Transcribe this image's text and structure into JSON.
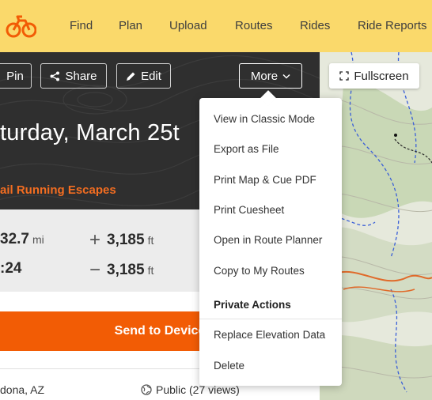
{
  "nav": {
    "items": [
      "Find",
      "Plan",
      "Upload",
      "Routes",
      "Rides",
      "Ride Reports"
    ]
  },
  "header": {
    "pin_label": "Pin",
    "share_label": "Share",
    "edit_label": "Edit",
    "more_label": "More",
    "title": "turday, March 25t",
    "collection": "ail Running Escapes"
  },
  "stats": {
    "distance_value": "32.7",
    "distance_unit": "mi",
    "time_value": ":24",
    "elevation_gain_value": "3,185",
    "elevation_gain_unit": "ft",
    "elevation_loss_value": "3,185",
    "elevation_loss_unit": "ft"
  },
  "actions": {
    "send_to_device": "Send to Device"
  },
  "footer": {
    "location": "dona, AZ",
    "visibility": "Public (27 views)"
  },
  "map": {
    "fullscreen_label": "Fullscreen"
  },
  "dropdown": {
    "items": [
      "View in Classic Mode",
      "Export as File",
      "Print Map & Cue PDF",
      "Print Cuesheet",
      "Open in Route Planner",
      "Copy to My Routes"
    ],
    "private_header": "Private Actions",
    "private_items": [
      "Replace Elevation Data",
      "Delete"
    ]
  },
  "colors": {
    "nav_bg": "#fad96b",
    "accent": "#f25c05",
    "hero_bg": "#2f2f2f"
  }
}
